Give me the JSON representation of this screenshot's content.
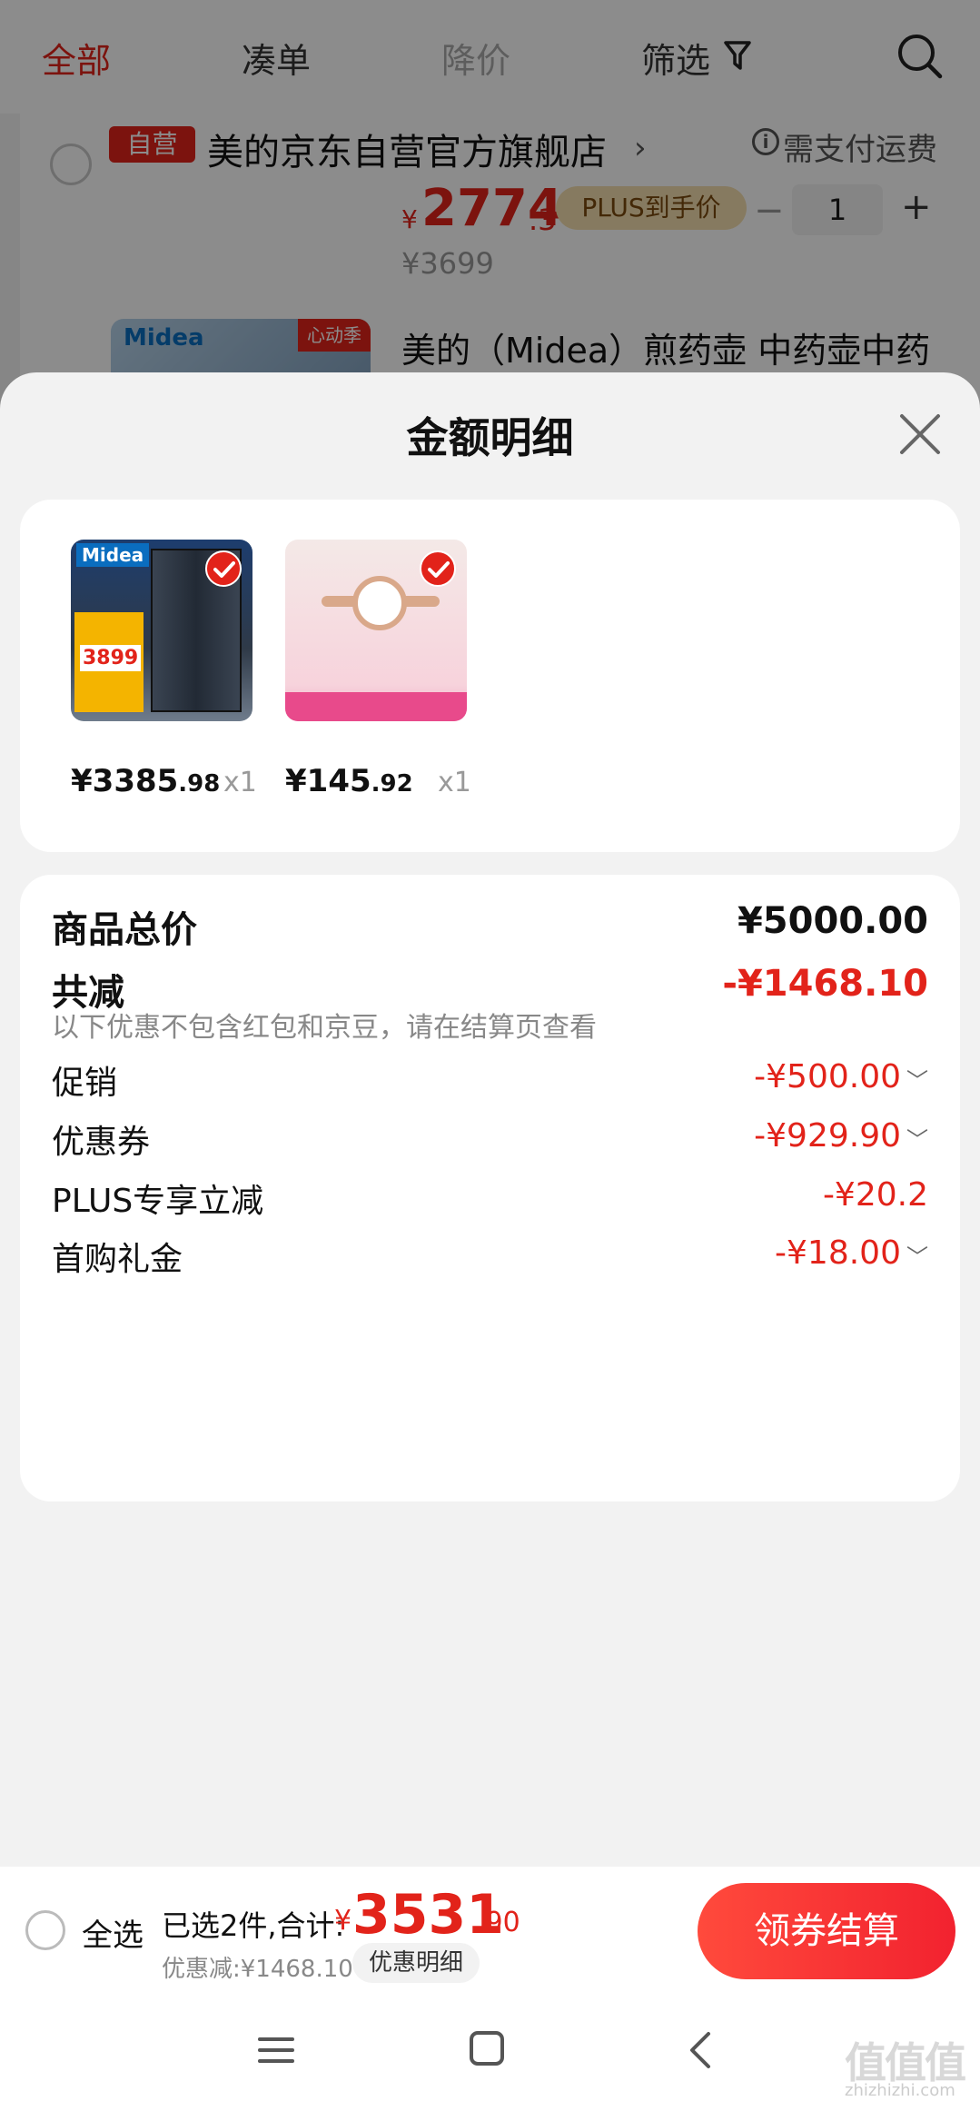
{
  "top_tabs": [
    {
      "label": "全部"
    },
    {
      "label": "凑单"
    },
    {
      "label": "降价"
    },
    {
      "label": "筛选"
    }
  ],
  "cart": {
    "self_badge": "自营",
    "store_name": "美的京东自营官方旗舰店",
    "store_arrow": "›",
    "shipping_note": "需支付运费",
    "item1": {
      "currency": "¥",
      "price_int": "2774",
      "price_dec": ".3",
      "plus_badge": "PLUS到手价",
      "qty": "1",
      "minus": "−",
      "plus": "+",
      "orig_price": "¥3699"
    },
    "item2": {
      "brand": "Midea",
      "tag": "心动季",
      "title": "美的（Midea）煎药壶 中药壶中药"
    }
  },
  "sheet": {
    "title": "金额明细",
    "products": [
      {
        "brand": "Midea",
        "promo": "3899",
        "price_int": "¥3385",
        "price_dec": ".98",
        "qty": "x1"
      },
      {
        "price_int": "¥145",
        "price_dec": ".92",
        "qty": "x1"
      }
    ],
    "total_label": "商品总价",
    "total_value": "¥5000.00",
    "reduce_label": "共减",
    "reduce_value": "-¥1468.10",
    "reduce_note": "以下优惠不包含红包和京豆，请在结算页查看",
    "rows": [
      {
        "label": "促销",
        "value": "-¥500.00",
        "chev": "﹀"
      },
      {
        "label": "优惠券",
        "value": "-¥929.90",
        "chev": "﹀"
      },
      {
        "label": "PLUS专享立减",
        "value": "-¥20.2",
        "chev": ""
      },
      {
        "label": "首购礼金",
        "value": "-¥18.00",
        "chev": "﹀"
      }
    ]
  },
  "bottom": {
    "select_all": "全选",
    "selected_info": "已选2件,合计:",
    "total_cur": "¥",
    "total_int": "3531",
    "total_dec": ".90",
    "discount": "优惠减:¥1468.10",
    "detail_link": "优惠明细",
    "checkout": "领券结算"
  },
  "watermark": {
    "text": "值值值",
    "sub": "zhizhizhi.com"
  },
  "colors": {
    "accent": "#e2231a",
    "plus_badge_bg": "#f5dfb0",
    "overlay": "rgba(0,0,0,0.45)"
  }
}
